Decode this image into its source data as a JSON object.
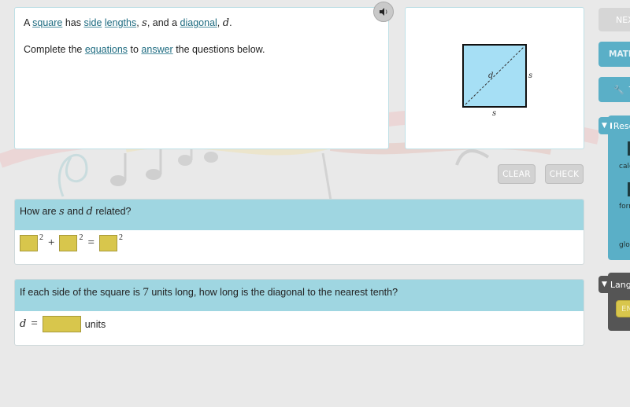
{
  "intro": {
    "line1": {
      "t1": "A ",
      "square": "square",
      "t2": " has ",
      "side": "side",
      "t3": " ",
      "lengths": "lengths",
      "t4": ", ",
      "s": "s",
      "t5": ", and a ",
      "diagonal": "diagonal",
      "t6": ", ",
      "d": "d",
      "t7": "."
    },
    "line2": {
      "t1": "Complete the ",
      "equations": "equations",
      "t2": " to ",
      "answer": "answer",
      "t3": " the questions below."
    }
  },
  "audio": {
    "icon": "speaker-icon"
  },
  "figure": {
    "side_label_right": "s",
    "side_label_bottom": "s",
    "diagonal_label": "d",
    "fill_color": "#a6dff5"
  },
  "actions": {
    "clear": "CLEAR",
    "check": "CHECK"
  },
  "questions": [
    {
      "prompt_pre": "How are ",
      "var1": "s",
      "prompt_mid": " and ",
      "var2": "d",
      "prompt_post": " related?",
      "equation": {
        "exp": "2",
        "plus": "+",
        "equals": "=",
        "blanks": [
          "",
          "",
          ""
        ]
      }
    },
    {
      "prompt_pre": "If each side of the square is ",
      "num": "7",
      "prompt_post": " units long, how long is the diagonal to the nearest tenth?",
      "answer_var": "d",
      "equals": "=",
      "blank": "",
      "unit": "units"
    }
  ],
  "sidebar": {
    "next": "NEXT",
    "math": "MATH",
    "tools": "Tools",
    "resources": {
      "label": "Resources",
      "items": [
        "calculator",
        "formulas",
        "glossary"
      ]
    },
    "language": {
      "label": "Language",
      "current": "EN"
    }
  },
  "colors": {
    "accent": "#5aafc7",
    "question_header": "#9fd6e1",
    "answer_box": "#d8c64c",
    "link": "#1e6b80"
  }
}
